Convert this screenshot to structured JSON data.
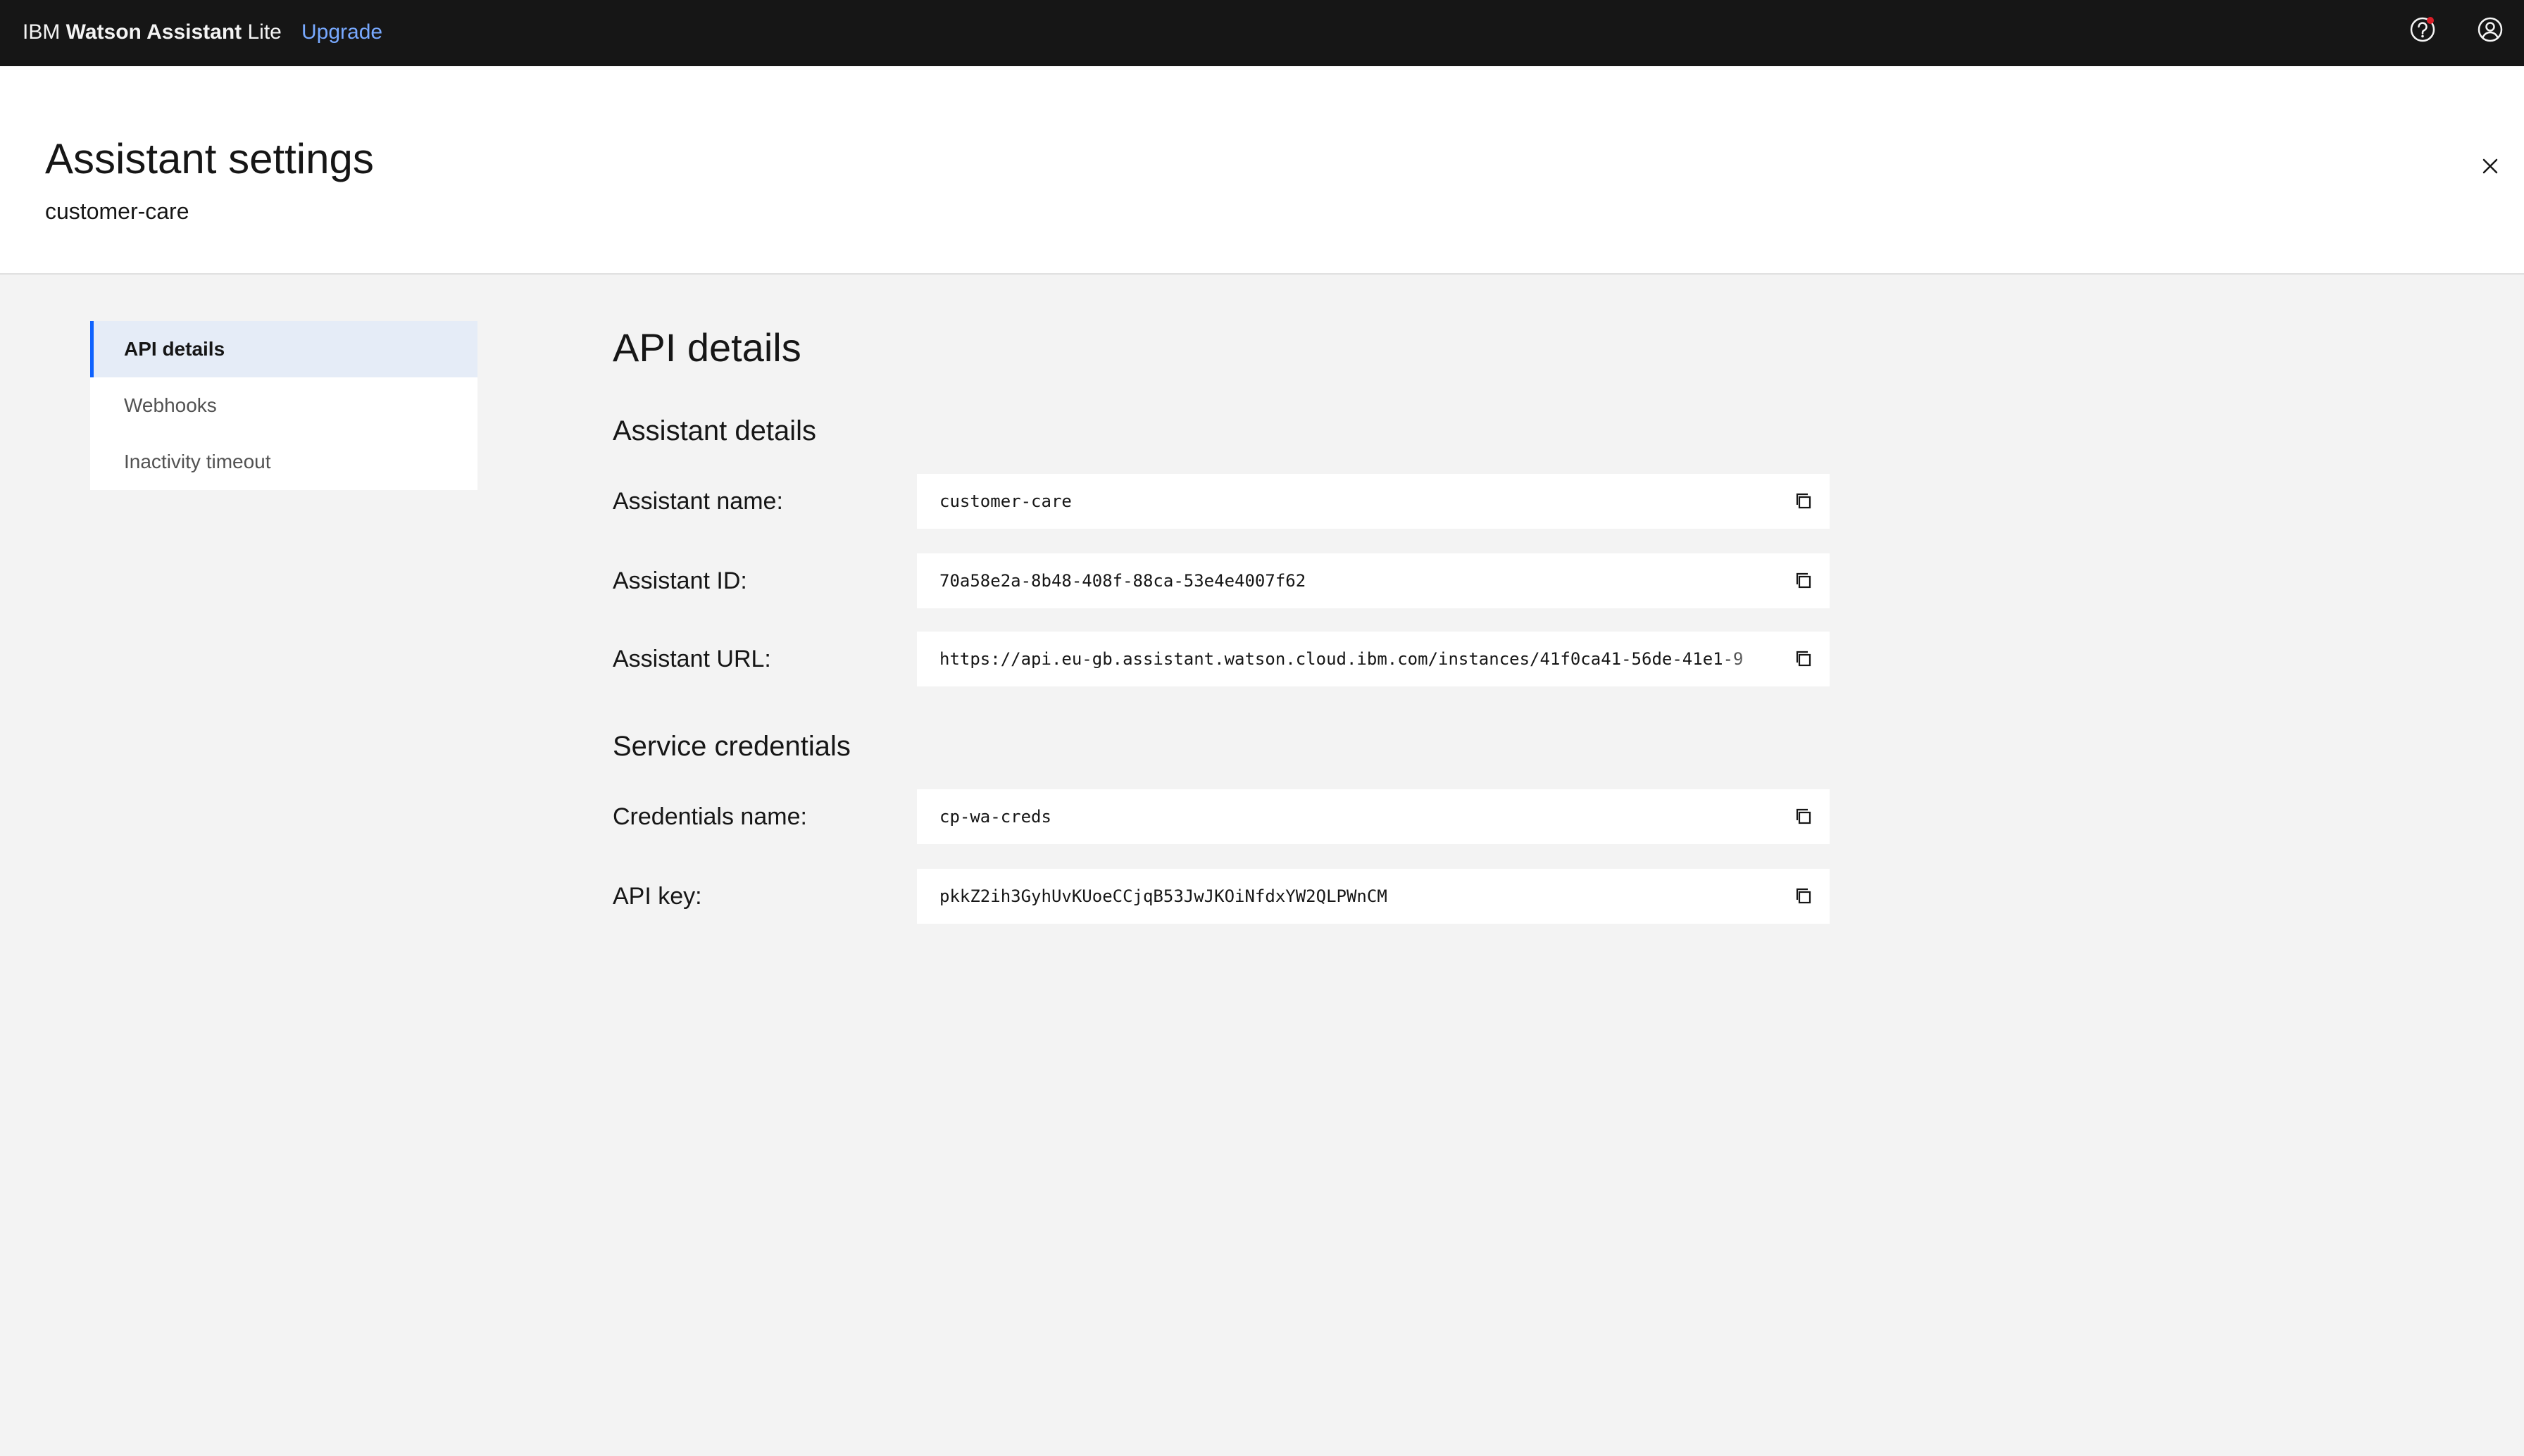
{
  "topbar": {
    "brand_prefix": "IBM ",
    "brand_name": "Watson Assistant",
    "brand_suffix": " Lite",
    "upgrade_label": "Upgrade",
    "icons": [
      "help-icon",
      "user-avatar-icon"
    ]
  },
  "header": {
    "title": "Assistant settings",
    "subtitle": "customer-care",
    "close_icon": "close-icon"
  },
  "sidebar": {
    "items": [
      {
        "label": "API details",
        "active": true
      },
      {
        "label": "Webhooks",
        "active": false
      },
      {
        "label": "Inactivity timeout",
        "active": false
      }
    ]
  },
  "main": {
    "title": "API details",
    "assistant_details": {
      "heading": "Assistant details",
      "fields": [
        {
          "label": "Assistant name:",
          "value": "customer-care"
        },
        {
          "label": "Assistant ID:",
          "value": "70a58e2a-8b48-408f-88ca-53e4e4007f62"
        },
        {
          "label": "Assistant URL:",
          "value": "https://api.eu-gb.assistant.watson.cloud.ibm.com/instances/41f0ca41-56de-41e1-9"
        }
      ]
    },
    "service_credentials": {
      "heading": "Service credentials",
      "fields": [
        {
          "label": "Credentials name:",
          "value": "cp-wa-creds"
        },
        {
          "label": "API key:",
          "value": "pkkZ2ih3GyhUvKUoeCCjqB53JwJKOiNfdxYW2QLPWnCM"
        }
      ]
    }
  },
  "colors": {
    "topbar_bg": "#161616",
    "link": "#78a9ff",
    "active_nav_border": "#0f62fe",
    "active_nav_bg": "#e5ecf7",
    "page_bg": "#f3f3f3"
  }
}
